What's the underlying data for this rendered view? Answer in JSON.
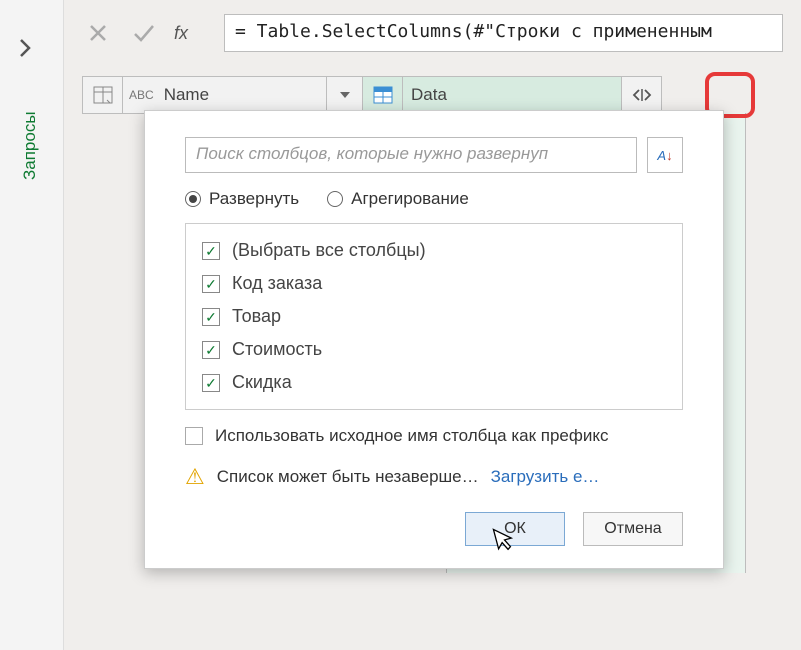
{
  "sidebar": {
    "label": "Запросы"
  },
  "formula": {
    "value": "= Table.SelectColumns(#\"Строки с примененным"
  },
  "columns": {
    "col1": {
      "label": "Name",
      "type": "ABC"
    },
    "col2": {
      "label": "Data",
      "type": "table"
    }
  },
  "popup": {
    "search_placeholder": "Поиск столбцов, которые нужно развернуп",
    "radio": {
      "expand": "Развернуть",
      "aggregate": "Агрегирование"
    },
    "items": {
      "select_all": "(Выбрать все столбцы)",
      "c1": "Код заказа",
      "c2": "Товар",
      "c3": "Стоимость",
      "c4": "Скидка"
    },
    "prefix_label": "Использовать исходное имя столбца как префикс",
    "warning": "Список может быть незаверше…",
    "load_more": "Загрузить е…",
    "ok": "ОК",
    "cancel": "Отмена"
  }
}
